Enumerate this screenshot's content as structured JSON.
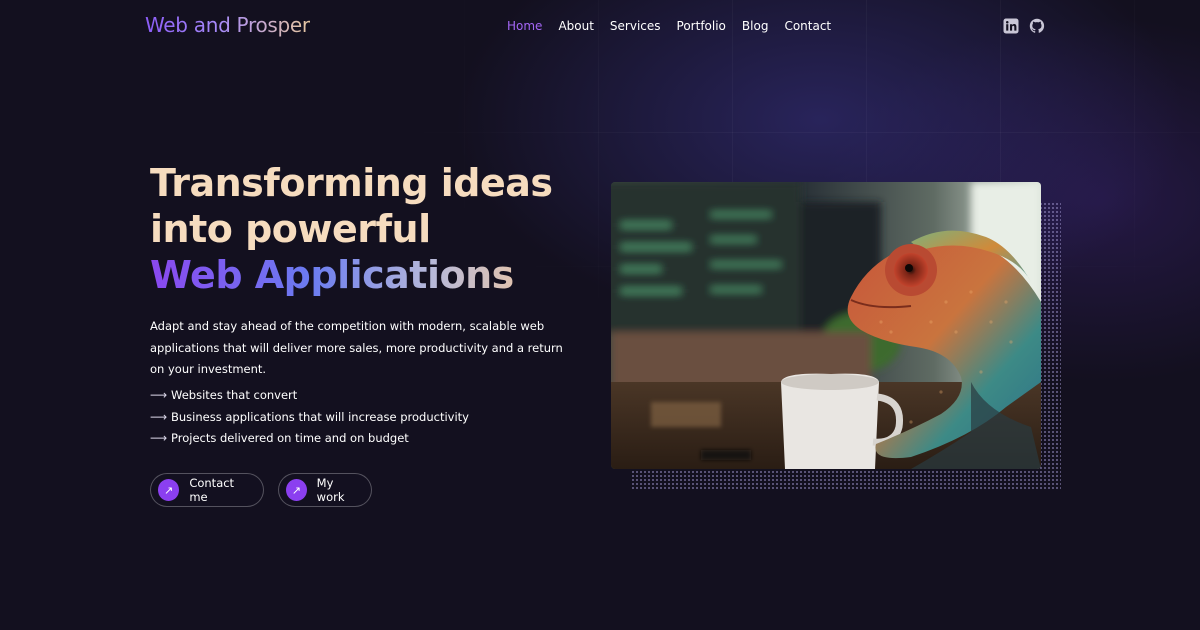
{
  "header": {
    "logo": "Web and Prosper",
    "nav": [
      {
        "label": "Home",
        "active": true
      },
      {
        "label": "About"
      },
      {
        "label": "Services"
      },
      {
        "label": "Portfolio"
      },
      {
        "label": "Blog"
      },
      {
        "label": "Contact"
      }
    ],
    "social": [
      {
        "icon": "linkedin-icon"
      },
      {
        "icon": "github-icon"
      }
    ]
  },
  "hero": {
    "headline_line1": "Transforming ideas",
    "headline_line2": "into powerful",
    "headline_highlight": "Web Applications",
    "lead": "Adapt and stay ahead of the competition with modern, scalable web applications that will deliver more sales, more productivity and a return on your investment.",
    "features": [
      "Websites that convert",
      "Business applications that will increase productivity",
      "Projects delivered on time and on budget"
    ],
    "buttons": {
      "contact_label": "Contact me",
      "work_label": "My work"
    },
    "image": {
      "subject": "chameleon-at-desk-image"
    }
  },
  "colors": {
    "background": "#13101f",
    "accent": "#8b3ff0",
    "nav_active": "#a466f5",
    "headline": "#f6dcbf"
  }
}
